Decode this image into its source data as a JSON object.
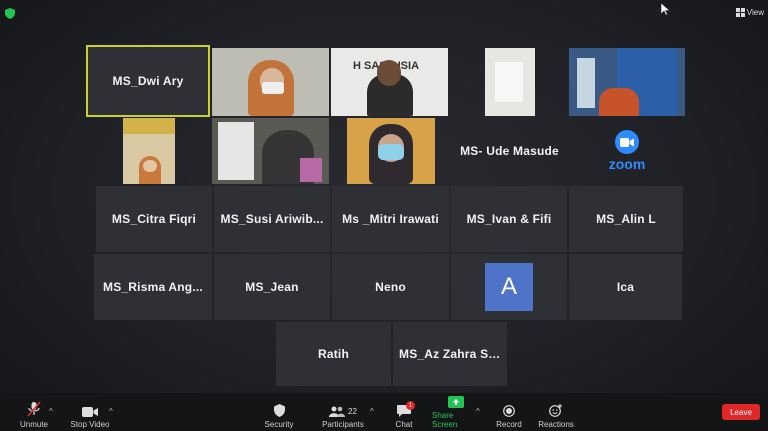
{
  "topbar": {
    "view_label": "View"
  },
  "tiles": {
    "dwi_ary": "MS_Dwi Ary",
    "ude_masude": "MS- Ude Masude",
    "citra": "MS_Citra Fiqri",
    "susi": "MS_Susi  Ariwib...",
    "mitri": "Ms _Mitri Irawati",
    "ivan": "MS_Ivan & Fifi",
    "alin": "MS_Alin L",
    "risma": "MS_Risma  Ang...",
    "jean": "MS_Jean",
    "neno": "Neno",
    "avatar_letter": "A",
    "ica": "Ica",
    "ratih": "Ratih",
    "az_zahra": "MS_Az  Zahra  Sy...",
    "zoom_word": "zoom",
    "video_banner_text": "H  SASI  USIA"
  },
  "toolbar": {
    "unmute": "Unmute",
    "stop_video": "Stop Video",
    "security": "Security",
    "participants": "Participants",
    "participants_count": "22",
    "chat": "Chat",
    "chat_badge": "1",
    "share_screen": "Share Screen",
    "record": "Record",
    "reactions": "Reactions",
    "leave": "Leave"
  },
  "colors": {
    "active_speaker_border": "#c9d12a",
    "share_green": "#23c552",
    "leave_red": "#e02828",
    "zoom_blue": "#2d8cff",
    "avatar_blue": "#4f73c8"
  }
}
